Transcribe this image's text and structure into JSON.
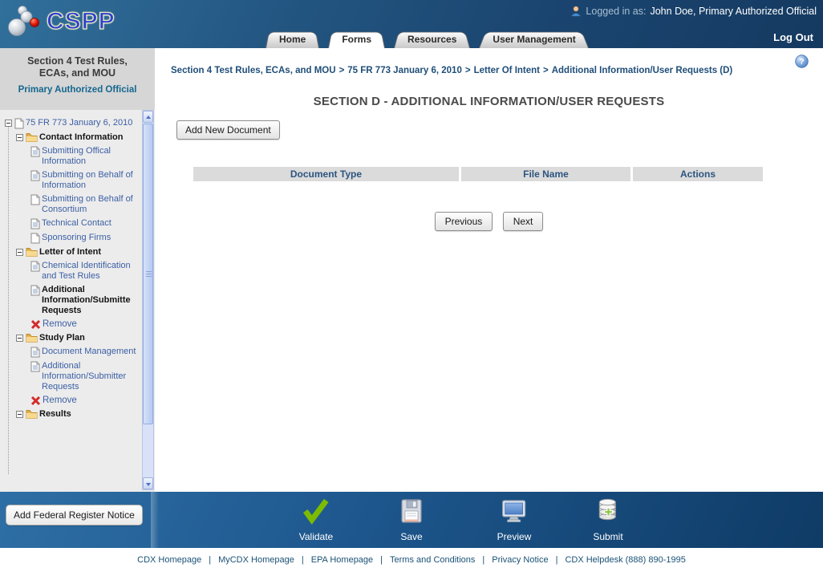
{
  "header": {
    "logo_text": "CSPP",
    "logged_in_prefix": "Logged in as:",
    "logged_in_user": "John Doe, Primary Authorized Official",
    "logout_label": "Log Out",
    "tabs": [
      {
        "label": "Home",
        "active": false
      },
      {
        "label": "Forms",
        "active": true
      },
      {
        "label": "Resources",
        "active": false
      },
      {
        "label": "User Management",
        "active": false
      }
    ]
  },
  "sidebar": {
    "title": "Section 4 Test Rules, ECAs, and MOU",
    "role": "Primary Authorized Official",
    "tree": [
      {
        "label": "75 FR 773 January 6, 2010"
      },
      {
        "label": "Contact Information"
      },
      {
        "label": "Submitting Offical Information"
      },
      {
        "label": "Submitting on Behalf of Information"
      },
      {
        "label": "Submitting on Behalf of Consortium"
      },
      {
        "label": "Technical Contact"
      },
      {
        "label": "Sponsoring Firms"
      },
      {
        "label": "Letter of Intent"
      },
      {
        "label": "Chemical Identification and Test Rules"
      },
      {
        "label": "Additional Information/Submitte Requests"
      },
      {
        "label": "Remove"
      },
      {
        "label": "Study Plan"
      },
      {
        "label": "Document Management"
      },
      {
        "label": "Additional Information/Submitter Requests"
      },
      {
        "label": "Remove"
      },
      {
        "label": "Results"
      }
    ],
    "add_fr_notice_label": "Add Federal Register Notice"
  },
  "main": {
    "breadcrumb": {
      "segments": [
        "Section 4 Test Rules, ECAs, and MOU",
        "75 FR 773 January 6, 2010",
        "Letter Of Intent",
        "Additional Information/User Requests (D)"
      ],
      "separator": ">"
    },
    "title": "SECTION D - ADDITIONAL INFORMATION/USER REQUESTS",
    "add_document_label": "Add New Document",
    "table": {
      "columns": [
        "Document Type",
        "File Name",
        "Actions"
      ],
      "rows": []
    },
    "pagination": {
      "previous_label": "Previous",
      "next_label": "Next"
    }
  },
  "toolbar": {
    "actions": [
      {
        "label": "Validate",
        "icon": "checkmark-icon"
      },
      {
        "label": "Save",
        "icon": "floppy-icon"
      },
      {
        "label": "Preview",
        "icon": "monitor-icon"
      },
      {
        "label": "Submit",
        "icon": "database-add-icon"
      }
    ]
  },
  "footer": {
    "links": [
      "CDX Homepage",
      "MyCDX Homepage",
      "EPA Homepage",
      "Terms and Conditions",
      "Privacy Notice",
      "CDX Helpdesk (888) 890-1995"
    ],
    "separator": "|"
  },
  "colors": {
    "header_blue": "#1c4a73",
    "toolbar_blue": "#1d568c",
    "accent_blue": "#1f4e79",
    "link_blue": "#3b5fa5",
    "table_header_bg": "#dbdbdb",
    "sidebar_head_bg": "#d6d6d6",
    "sidebar_bg": "#ececec",
    "validate_green": "#7cbb00",
    "remove_red": "#d42a2a"
  }
}
